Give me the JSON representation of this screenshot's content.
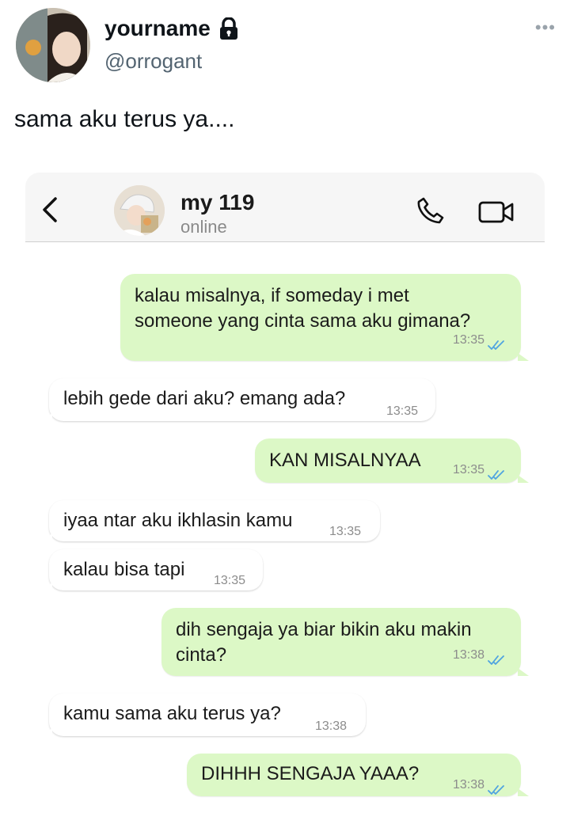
{
  "tweet": {
    "display_name": "yourname",
    "handle": "@orrogant",
    "more_label": "•••",
    "text": "sama aku terus ya...."
  },
  "chat": {
    "contact_name": "my 119",
    "contact_status": "online",
    "messages": [
      {
        "direction": "outgoing",
        "text": "kalau misalnya, if someday i met\nsomeone yang cinta sama aku gimana?",
        "time": "13:35",
        "read": true
      },
      {
        "direction": "incoming",
        "text": "lebih gede dari aku? emang ada?",
        "time": "13:35"
      },
      {
        "direction": "outgoing",
        "text": "KAN MISALNYAA",
        "time": "13:35",
        "read": true
      },
      {
        "direction": "incoming",
        "text": "iyaa ntar aku ikhlasin kamu",
        "time": "13:35"
      },
      {
        "direction": "incoming",
        "text": "kalau bisa tapi",
        "time": "13:35"
      },
      {
        "direction": "outgoing",
        "text": "dih sengaja ya biar bikin aku makin\ncinta?",
        "time": "13:38",
        "read": true
      },
      {
        "direction": "incoming",
        "text": "kamu sama aku terus ya?",
        "time": "13:38"
      },
      {
        "direction": "outgoing",
        "text": "DIHHH SENGAJA YAAA?",
        "time": "13:38",
        "read": true
      }
    ]
  },
  "icons": {
    "lock": "lock-icon",
    "more": "more-icon",
    "back": "chevron-left-icon",
    "call": "phone-icon",
    "video": "video-camera-icon",
    "read_receipt": "double-check-icon"
  },
  "colors": {
    "outgoing_bubble": "#dcf8c6",
    "incoming_bubble": "#ffffff",
    "read_ticks": "#4fa3e0",
    "handle": "#536471"
  }
}
